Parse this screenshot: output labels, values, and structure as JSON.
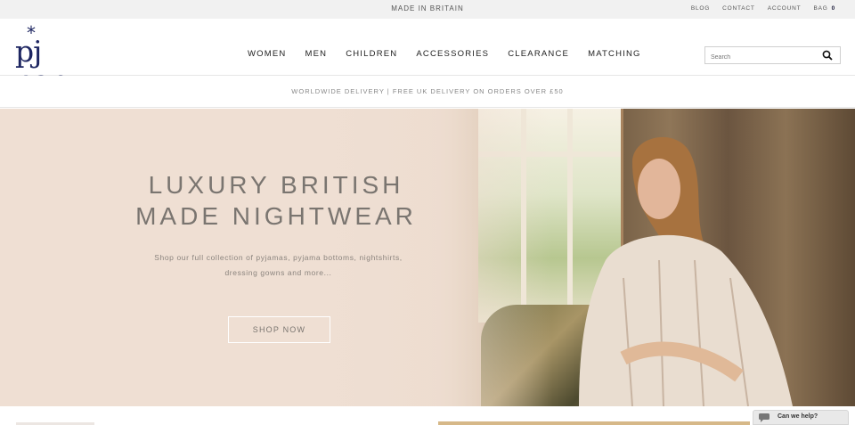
{
  "topbar": {
    "message": "MADE IN BRITAIN",
    "links": [
      "BLOG",
      "CONTACT",
      "ACCOUNT"
    ],
    "bag_label": "BAG",
    "bag_count": "0"
  },
  "logo": {
    "text": "pj pan"
  },
  "nav": [
    "WOMEN",
    "MEN",
    "CHILDREN",
    "ACCESSORIES",
    "CLEARANCE",
    "MATCHING"
  ],
  "search": {
    "placeholder": "Search"
  },
  "delivery_banner": "WORLDWIDE DELIVERY | FREE UK DELIVERY ON ORDERS OVER £50",
  "hero": {
    "title_line1": "LUXURY BRITISH",
    "title_line2": "MADE NIGHTWEAR",
    "subtitle_line1": "Shop our full collection of pyjamas, pyjama bottoms, nightshirts,",
    "subtitle_line2": "dressing gowns and more...",
    "cta": "SHOP NOW"
  },
  "chat": {
    "label": "Can we help?"
  },
  "colors": {
    "brand": "#1d2561",
    "hero_bg": "#efdfd3",
    "hero_text": "#7a7570"
  }
}
